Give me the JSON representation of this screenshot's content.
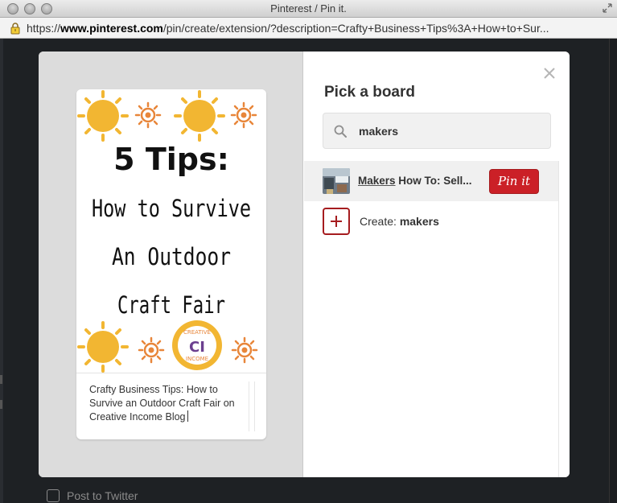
{
  "window": {
    "title": "Pinterest / Pin it."
  },
  "url": {
    "scheme": "https://",
    "host": "www.pinterest.com",
    "path": "/pin/create/extension/?description=Crafty+Business+Tips%3A+How+to+Sur..."
  },
  "pin": {
    "headline": "5 Tips:",
    "lines": [
      "How to Survive",
      "An Outdoor",
      "Craft Fair"
    ],
    "logo": {
      "top": "CREATIVE",
      "mid": "CI",
      "bottom": "INCOME"
    },
    "description": "Crafty Business Tips: How to Survive an Outdoor Craft Fair on Creative Income Blog"
  },
  "board_picker": {
    "title": "Pick a board",
    "search_value": "makers",
    "boards": [
      {
        "highlight": "Makers",
        "rest": " How To: Sell...",
        "button": "Pin it"
      }
    ],
    "create_prefix": "Create: ",
    "create_name": "makers"
  },
  "footer": {
    "twitter_label": "Post to Twitter"
  },
  "colors": {
    "pinterest_red": "#cb2027",
    "sun": "#f2b632",
    "modal_left": "#dcdcdc"
  }
}
